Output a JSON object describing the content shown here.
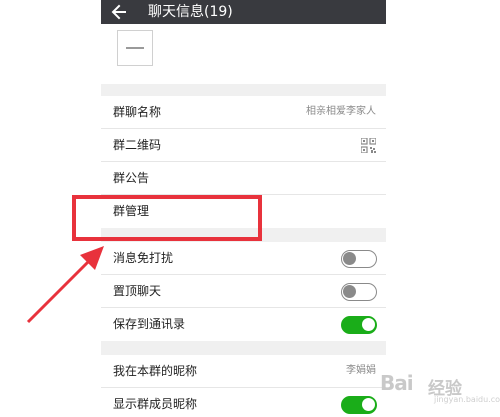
{
  "header": {
    "title": "聊天信息(19)",
    "back_icon": "back-arrow-icon"
  },
  "members": {
    "add_icon": "minus-icon"
  },
  "group_info": [
    {
      "label": "群聊名称",
      "value": "相亲相爱李家人"
    },
    {
      "label": "群二维码",
      "icon": "qr-code-icon"
    },
    {
      "label": "群公告"
    },
    {
      "label": "群管理"
    }
  ],
  "chat_settings": [
    {
      "label": "消息免打扰",
      "toggle": false
    },
    {
      "label": "置顶聊天",
      "toggle": false
    },
    {
      "label": "保存到通讯录",
      "toggle": true
    }
  ],
  "nickname_settings": [
    {
      "label": "我在本群的昵称",
      "value": "李娟娟"
    },
    {
      "label": "显示群成员昵称",
      "toggle": true
    }
  ],
  "annotation": {
    "highlight_color": "#e8323c"
  },
  "watermark": {
    "brand": "Bai",
    "suffix": "经验",
    "sub": "jingyan.baidu.com"
  },
  "colors": {
    "topbar": "#393a3f",
    "toggle_on": "#1aad19",
    "background": "#f0f0f0"
  }
}
